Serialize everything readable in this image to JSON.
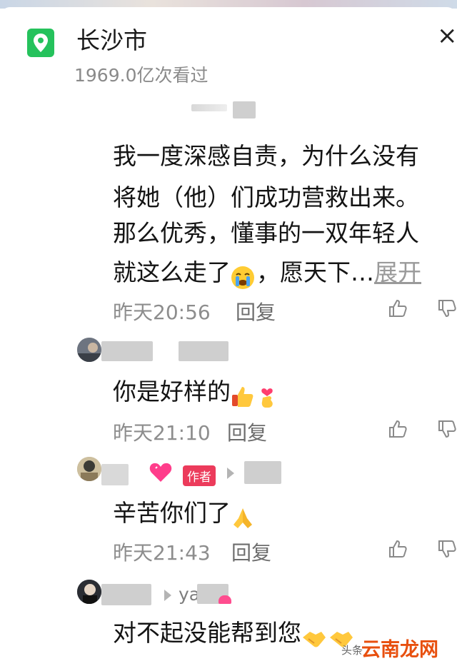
{
  "header": {
    "location_icon": "location-pin-icon",
    "title": "长沙市",
    "views": "1969.0亿次看过",
    "close": "×"
  },
  "comments": [
    {
      "lines": [
        "我一度深感自责，为什么没有",
        "将她（他）们成功营救出来。",
        "那么优秀，懂事的一双年轻人",
        "就这么走了"
      ],
      "tail": "，愿天下…",
      "expand": "展开",
      "emoji": "crying-face-emoji",
      "time": "昨天20:56",
      "reply": "回复"
    },
    {
      "text": "你是好样的",
      "emojis": [
        "thumbs-up-emoji",
        "finger-heart-emoji"
      ],
      "time": "昨天21:10",
      "reply": "回复"
    },
    {
      "badge": "作者",
      "text": "辛苦你们了",
      "emojis": [
        "folded-hands-emoji"
      ],
      "time": "昨天21:43",
      "reply": "回复"
    },
    {
      "reply_to": "ya",
      "text": "对不起没能帮到您",
      "emojis": [
        "handshake-emoji",
        "handshake-emoji"
      ]
    }
  ],
  "watermark": {
    "prefix": "头条",
    "brand": "云南龙网"
  }
}
